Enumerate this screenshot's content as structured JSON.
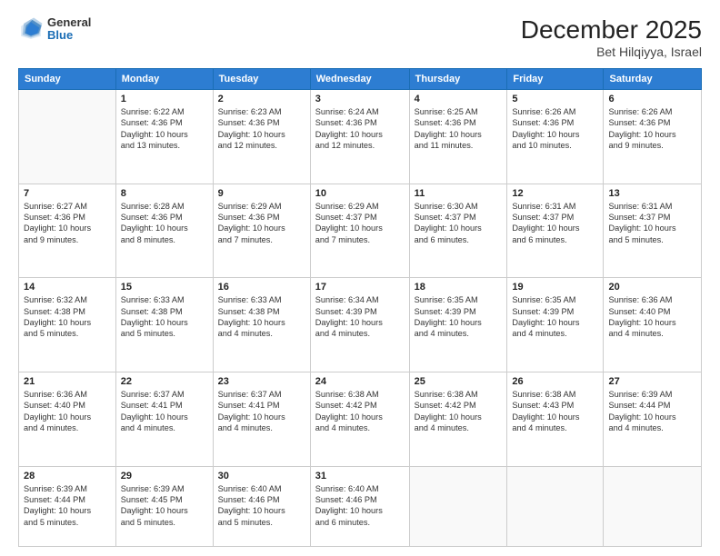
{
  "logo": {
    "general": "General",
    "blue": "Blue"
  },
  "title": "December 2025",
  "location": "Bet Hilqiyya, Israel",
  "weekdays": [
    "Sunday",
    "Monday",
    "Tuesday",
    "Wednesday",
    "Thursday",
    "Friday",
    "Saturday"
  ],
  "weeks": [
    [
      {
        "day": "",
        "info": ""
      },
      {
        "day": "1",
        "info": "Sunrise: 6:22 AM\nSunset: 4:36 PM\nDaylight: 10 hours\nand 13 minutes."
      },
      {
        "day": "2",
        "info": "Sunrise: 6:23 AM\nSunset: 4:36 PM\nDaylight: 10 hours\nand 12 minutes."
      },
      {
        "day": "3",
        "info": "Sunrise: 6:24 AM\nSunset: 4:36 PM\nDaylight: 10 hours\nand 12 minutes."
      },
      {
        "day": "4",
        "info": "Sunrise: 6:25 AM\nSunset: 4:36 PM\nDaylight: 10 hours\nand 11 minutes."
      },
      {
        "day": "5",
        "info": "Sunrise: 6:26 AM\nSunset: 4:36 PM\nDaylight: 10 hours\nand 10 minutes."
      },
      {
        "day": "6",
        "info": "Sunrise: 6:26 AM\nSunset: 4:36 PM\nDaylight: 10 hours\nand 9 minutes."
      }
    ],
    [
      {
        "day": "7",
        "info": "Sunrise: 6:27 AM\nSunset: 4:36 PM\nDaylight: 10 hours\nand 9 minutes."
      },
      {
        "day": "8",
        "info": "Sunrise: 6:28 AM\nSunset: 4:36 PM\nDaylight: 10 hours\nand 8 minutes."
      },
      {
        "day": "9",
        "info": "Sunrise: 6:29 AM\nSunset: 4:36 PM\nDaylight: 10 hours\nand 7 minutes."
      },
      {
        "day": "10",
        "info": "Sunrise: 6:29 AM\nSunset: 4:37 PM\nDaylight: 10 hours\nand 7 minutes."
      },
      {
        "day": "11",
        "info": "Sunrise: 6:30 AM\nSunset: 4:37 PM\nDaylight: 10 hours\nand 6 minutes."
      },
      {
        "day": "12",
        "info": "Sunrise: 6:31 AM\nSunset: 4:37 PM\nDaylight: 10 hours\nand 6 minutes."
      },
      {
        "day": "13",
        "info": "Sunrise: 6:31 AM\nSunset: 4:37 PM\nDaylight: 10 hours\nand 5 minutes."
      }
    ],
    [
      {
        "day": "14",
        "info": "Sunrise: 6:32 AM\nSunset: 4:38 PM\nDaylight: 10 hours\nand 5 minutes."
      },
      {
        "day": "15",
        "info": "Sunrise: 6:33 AM\nSunset: 4:38 PM\nDaylight: 10 hours\nand 5 minutes."
      },
      {
        "day": "16",
        "info": "Sunrise: 6:33 AM\nSunset: 4:38 PM\nDaylight: 10 hours\nand 4 minutes."
      },
      {
        "day": "17",
        "info": "Sunrise: 6:34 AM\nSunset: 4:39 PM\nDaylight: 10 hours\nand 4 minutes."
      },
      {
        "day": "18",
        "info": "Sunrise: 6:35 AM\nSunset: 4:39 PM\nDaylight: 10 hours\nand 4 minutes."
      },
      {
        "day": "19",
        "info": "Sunrise: 6:35 AM\nSunset: 4:39 PM\nDaylight: 10 hours\nand 4 minutes."
      },
      {
        "day": "20",
        "info": "Sunrise: 6:36 AM\nSunset: 4:40 PM\nDaylight: 10 hours\nand 4 minutes."
      }
    ],
    [
      {
        "day": "21",
        "info": "Sunrise: 6:36 AM\nSunset: 4:40 PM\nDaylight: 10 hours\nand 4 minutes."
      },
      {
        "day": "22",
        "info": "Sunrise: 6:37 AM\nSunset: 4:41 PM\nDaylight: 10 hours\nand 4 minutes."
      },
      {
        "day": "23",
        "info": "Sunrise: 6:37 AM\nSunset: 4:41 PM\nDaylight: 10 hours\nand 4 minutes."
      },
      {
        "day": "24",
        "info": "Sunrise: 6:38 AM\nSunset: 4:42 PM\nDaylight: 10 hours\nand 4 minutes."
      },
      {
        "day": "25",
        "info": "Sunrise: 6:38 AM\nSunset: 4:42 PM\nDaylight: 10 hours\nand 4 minutes."
      },
      {
        "day": "26",
        "info": "Sunrise: 6:38 AM\nSunset: 4:43 PM\nDaylight: 10 hours\nand 4 minutes."
      },
      {
        "day": "27",
        "info": "Sunrise: 6:39 AM\nSunset: 4:44 PM\nDaylight: 10 hours\nand 4 minutes."
      }
    ],
    [
      {
        "day": "28",
        "info": "Sunrise: 6:39 AM\nSunset: 4:44 PM\nDaylight: 10 hours\nand 5 minutes."
      },
      {
        "day": "29",
        "info": "Sunrise: 6:39 AM\nSunset: 4:45 PM\nDaylight: 10 hours\nand 5 minutes."
      },
      {
        "day": "30",
        "info": "Sunrise: 6:40 AM\nSunset: 4:46 PM\nDaylight: 10 hours\nand 5 minutes."
      },
      {
        "day": "31",
        "info": "Sunrise: 6:40 AM\nSunset: 4:46 PM\nDaylight: 10 hours\nand 6 minutes."
      },
      {
        "day": "",
        "info": ""
      },
      {
        "day": "",
        "info": ""
      },
      {
        "day": "",
        "info": ""
      }
    ]
  ]
}
